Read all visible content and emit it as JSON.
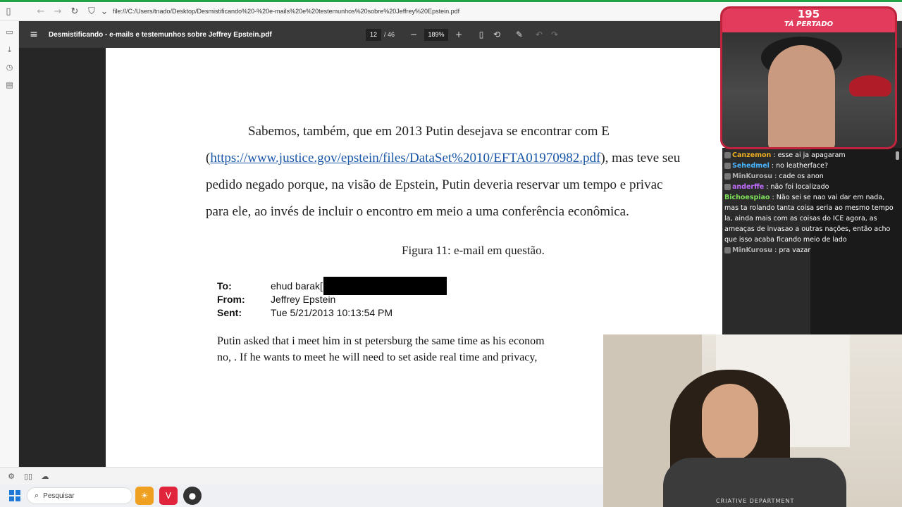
{
  "browser": {
    "url": "file:///C:/Users/tnado/Desktop/Desmistificando%20-%20e-mails%20e%20testemunhos%20sobre%20Jeffrey%20Epstein.pdf",
    "accent_color": "#22a34a"
  },
  "pdf_toolbar": {
    "title": "Desmistificando - e-mails e testemunhos sobre Jeffrey Epstein.pdf",
    "current_page": "12",
    "total_pages": "/ 46",
    "zoom": "189%",
    "zoom_out": "−",
    "zoom_in": "+"
  },
  "document": {
    "para_lines": [
      "Sabemos, também, que em 2013 Putin desejava se encontrar com E",
      "https://www.justice.gov/epstein/files/DataSet%2010/EFTA01970982.pdf",
      "pedido negado porque, na visão de Epstein, Putin deveria reservar um tempo e privac",
      "para ele, ao invés de incluir o encontro em meio a uma conferência econômica."
    ],
    "line2_open": "(",
    "line2_close": "), mas teve seu",
    "caption": "Figura 11: e-mail em questão.",
    "email": {
      "to_label": "To:",
      "to_value": "ehud barak[",
      "from_label": "From:",
      "from_value": "Jeffrey Epstein",
      "sent_label": "Sent:",
      "sent_value": "Tue 5/21/2013 10:13:54 PM",
      "body_lines": [
        "Putin asked that i meet him in st petersburg the same time as his econom",
        "no,  .  If he wants to meet he will need to set aside real time and privacy,"
      ]
    }
  },
  "overlay": {
    "counter": "195",
    "counter_label": "TÁ PERTADO",
    "shirt_text": "CRIATIVE DEPARTMENT",
    "chat": [
      {
        "user": "Canzemon",
        "text": ": esse ai ja apagaram",
        "color": "#f0b020"
      },
      {
        "user": "Sehedmel",
        "text": ": no leatherface?",
        "color": "#4ab4ff"
      },
      {
        "user": "MinKurosu",
        "text": ": cade os anon",
        "color": "#b0b0b0"
      },
      {
        "user": "anderffe",
        "text": ": não foi localizado",
        "color": "#c06cff"
      },
      {
        "user": "Bichoespiao",
        "text": ": Não sei se nao vai dar em nada, mas ta rolando tanta coisa seria ao mesmo tempo la, ainda mais com as coisas do ICE agora, as ameaças de invasao a outras nações, então acho que isso acaba ficando meio de lado",
        "color": "#7ee05a"
      },
      {
        "user": "MinKurosu",
        "text": ": pra vazar",
        "color": "#b0b0b0"
      }
    ]
  },
  "taskbar": {
    "search_placeholder": "Pesquisar"
  }
}
